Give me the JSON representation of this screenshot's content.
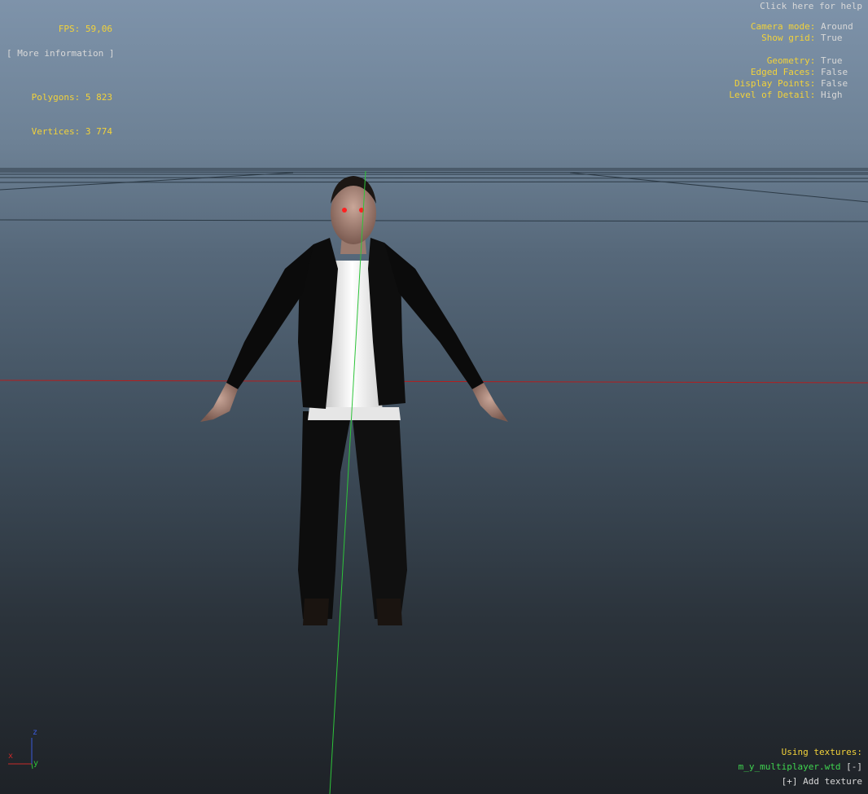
{
  "stats": {
    "fps_label": "FPS:",
    "fps_value": "59,06",
    "polygons_label": "Polygons:",
    "polygons_value": "5 823",
    "vertices_label": "Vertices:",
    "vertices_value": "3 774",
    "more_info": "[ More information ]"
  },
  "help": "Click here for help",
  "settings": {
    "camera_mode_label": "Camera mode:",
    "camera_mode_value": "Around",
    "show_grid_label": "Show grid:",
    "show_grid_value": "True",
    "geometry_label": "Geometry:",
    "geometry_value": "True",
    "edged_faces_label": "Edged Faces:",
    "edged_faces_value": "False",
    "display_points_label": "Display Points:",
    "display_points_value": "False",
    "lod_label": "Level of Detail:",
    "lod_value": "High"
  },
  "textures": {
    "heading": "Using textures:",
    "file": "m_y_multiplayer.wtd",
    "remove": "[-]",
    "add": "[+] Add texture"
  },
  "axes": {
    "x": "x",
    "y": "y",
    "z": "z"
  },
  "colors": {
    "key": "#f2d23a",
    "value": "#d8d8d8",
    "texture": "#3fd44f",
    "axis_x": "#c82a2a",
    "axis_y": "#2ec43a",
    "axis_z": "#3a5ad8"
  }
}
